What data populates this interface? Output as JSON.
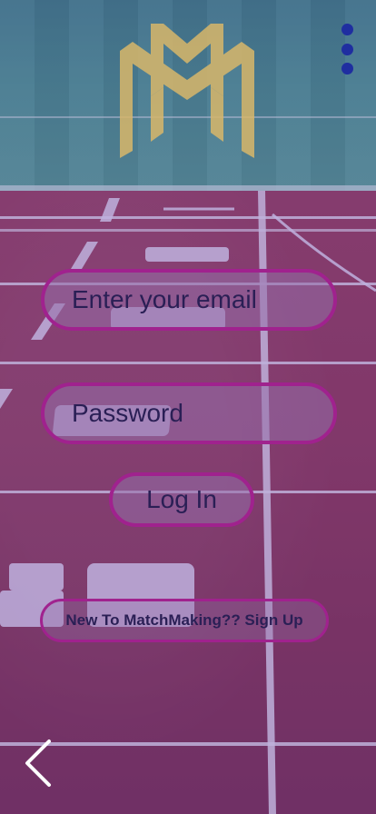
{
  "login_form": {
    "email_placeholder": "Enter your email",
    "password_placeholder": "Password",
    "login_label": "Log In"
  },
  "signup": {
    "label": "New To MatchMaking?? Sign Up"
  },
  "icons": {
    "logo": "mm-logo",
    "menu": "kebab-menu-icon",
    "back": "chevron-left-icon"
  },
  "colors": {
    "button_border": "#a0228e",
    "button_text": "#2a1f55",
    "menu_dots": "#1f2ea0",
    "logo_gold": "#d8b76a",
    "overlay_tint": "#4b37af"
  }
}
